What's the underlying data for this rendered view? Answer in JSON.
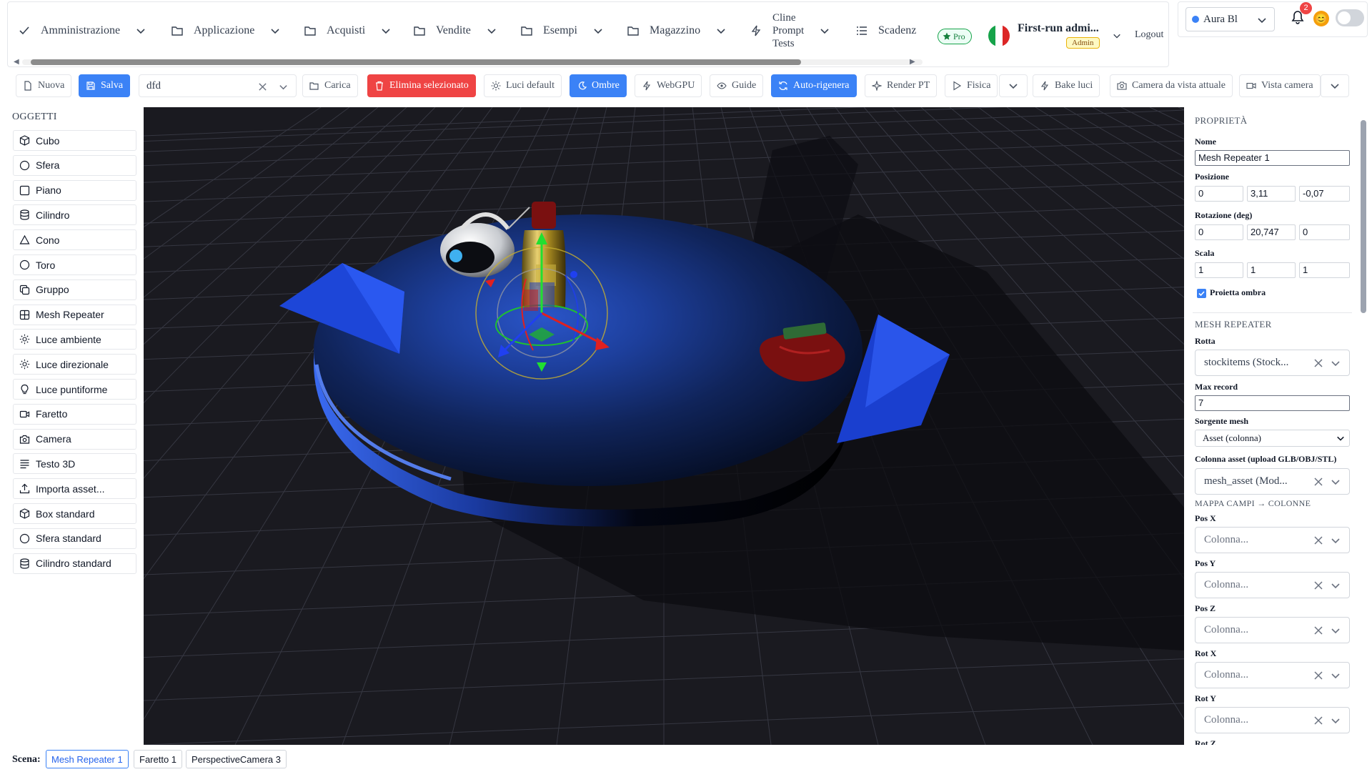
{
  "nav": {
    "items": [
      {
        "label": "Amministrazione",
        "icon": "check-icon"
      },
      {
        "label": "Applicazione",
        "icon": "folder-icon"
      },
      {
        "label": "Acquisti",
        "icon": "folder-icon"
      },
      {
        "label": "Vendite",
        "icon": "folder-icon"
      },
      {
        "label": "Esempi",
        "icon": "folder-icon"
      },
      {
        "label": "Magazzino",
        "icon": "folder-icon"
      },
      {
        "label": "Cline Prompt Tests",
        "icon": "bolt-icon",
        "lines": [
          "Cline",
          "Prompt",
          "Tests"
        ]
      },
      {
        "label": "Scadenz",
        "icon": "list-icon"
      }
    ],
    "pro_badge": "Pro",
    "user_name": "First-run admi...",
    "user_role": "Admin",
    "logout": "Logout"
  },
  "theme": {
    "selected": "Aura Bl",
    "notifications": "2",
    "avatar": "😊"
  },
  "toolbar": {
    "nuova": "Nuova",
    "salva": "Salva",
    "scene_input": "dfd",
    "carica": "Carica",
    "elimina": "Elimina selezionato",
    "luci_default": "Luci default",
    "ombre": "Ombre",
    "webgpu": "WebGPU",
    "guide": "Guide",
    "auto_rigenera": "Auto-rigenera",
    "render_pt": "Render PT",
    "fisica": "Fisica",
    "bake_luci": "Bake luci",
    "camera_vista": "Camera da vista attuale",
    "vista_camera": "Vista camera"
  },
  "objects": {
    "title": "OGGETTI",
    "items": [
      {
        "label": "Cubo",
        "icon": "cube-icon"
      },
      {
        "label": "Sfera",
        "icon": "circle-icon"
      },
      {
        "label": "Piano",
        "icon": "square-icon"
      },
      {
        "label": "Cilindro",
        "icon": "cylinder-icon"
      },
      {
        "label": "Cono",
        "icon": "triangle-icon"
      },
      {
        "label": "Toro",
        "icon": "circle-icon"
      },
      {
        "label": "Gruppo",
        "icon": "copy-icon"
      },
      {
        "label": "Mesh Repeater",
        "icon": "grid-icon"
      },
      {
        "label": "Luce ambiente",
        "icon": "sun-icon"
      },
      {
        "label": "Luce direzionale",
        "icon": "sun-icon"
      },
      {
        "label": "Luce puntiforme",
        "icon": "bulb-icon"
      },
      {
        "label": "Faretto",
        "icon": "video-icon"
      },
      {
        "label": "Camera",
        "icon": "camera-icon"
      },
      {
        "label": "Testo 3D",
        "icon": "text-icon"
      },
      {
        "label": "Importa asset...",
        "icon": "upload-icon"
      },
      {
        "label": "Box standard",
        "icon": "cube-icon"
      },
      {
        "label": "Sfera standard",
        "icon": "circle-icon"
      },
      {
        "label": "Cilindro standard",
        "icon": "cylinder-icon"
      }
    ]
  },
  "properties": {
    "title": "PROPRIETÀ",
    "name_label": "Nome",
    "name_value": "Mesh Repeater 1",
    "position_label": "Posizione",
    "position": [
      "0",
      "3,11",
      "-0,07"
    ],
    "rotation_label": "Rotazione (deg)",
    "rotation": [
      "0",
      "20,747",
      "0"
    ],
    "scale_label": "Scala",
    "scale": [
      "1",
      "1",
      "1"
    ],
    "cast_shadow_label": "Proietta ombra",
    "cast_shadow": true,
    "mesh_repeater_title": "MESH REPEATER",
    "route_label": "Rotta",
    "route_value": "stockitems (Stock...",
    "max_record_label": "Max record",
    "max_record_value": "7",
    "mesh_source_label": "Sorgente mesh",
    "mesh_source_value": "Asset (colonna)",
    "asset_column_label": "Colonna asset (upload GLB/OBJ/STL)",
    "asset_column_value": "mesh_asset (Mod...",
    "field_map_title": "MAPPA CAMPI → COLONNE",
    "column_placeholder": "Colonna...",
    "fields": [
      "Pos X",
      "Pos Y",
      "Pos Z",
      "Rot X",
      "Rot Y",
      "Rot Z"
    ]
  },
  "scene": {
    "label": "Scena:",
    "items": [
      "Mesh Repeater 1",
      "Faretto 1",
      "PerspectiveCamera 3"
    ],
    "active": "Mesh Repeater 1"
  }
}
